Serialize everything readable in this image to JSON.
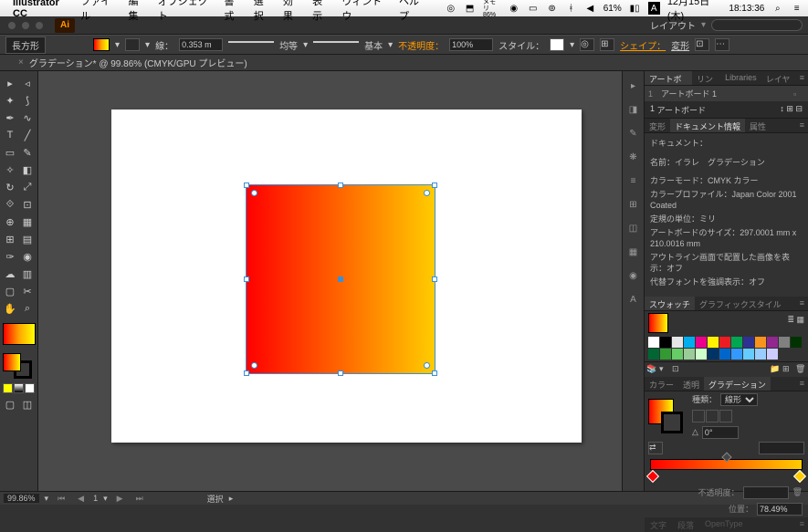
{
  "menubar": {
    "app": "Illustrator CC",
    "items": [
      "ファイル",
      "編集",
      "オブジェクト",
      "書式",
      "選択",
      "効果",
      "表示",
      "ウィンドウ",
      "ヘルプ"
    ],
    "memory": "メモリ\n86%",
    "battery": "61%",
    "date": "12月15日(木)",
    "time": "18:13:36"
  },
  "appbar": {
    "ai": "Ai",
    "layout": "レイアウト"
  },
  "control": {
    "shape": "長方形",
    "stroke_label": "線：",
    "stroke_w": "0.353 m",
    "uniform": "均等",
    "basic": "基本",
    "opacity_label": "不透明度：",
    "opacity": "100%",
    "style_label": "スタイル：",
    "shape_link": "シェイプ：",
    "transform": "変形"
  },
  "tab": {
    "close": "×",
    "title": "グラデーション* @ 99.86% (CMYK/GPU プレビュー)"
  },
  "panels": {
    "artboard_tabs": [
      "アートボード",
      "リンク",
      "Libraries",
      "レイヤー"
    ],
    "artboard_list_num": "1",
    "artboard_list_name": "アートボード 1",
    "artboard_footer_num": "1",
    "artboard_footer_label": "アートボード",
    "doc_tabs": [
      "変形",
      "ドキュメント情報",
      "属性"
    ],
    "doc_lines": {
      "doc": "ドキュメント：",
      "name": "名前：イラレ　グラデーション",
      "mode": "カラーモード：CMYK カラー",
      "profile": "カラープロファイル：Japan Color 2001 Coated",
      "ruler": "定規の単位：ミリ",
      "size": "アートボードのサイズ：297.0001 mm x 210.0016 mm",
      "outline": "アウトライン画面で配置した画像を表示：オフ",
      "font": "代替フォントを強調表示：オフ"
    },
    "swatch_tabs": [
      "スウォッチ",
      "グラフィックスタイル"
    ],
    "color_tabs": [
      "カラー",
      "透明",
      "グラデーション"
    ],
    "grad": {
      "type_label": "種類：",
      "type_value": "線形",
      "angle": "0°",
      "opacity_label": "不透明度：",
      "pos_label": "位置：",
      "pos_value": "78.49%"
    },
    "bottom_tabs": [
      "文字",
      "段落",
      "OpenType"
    ]
  },
  "status": {
    "zoom": "99.86%",
    "selected": "選択"
  },
  "swatches": [
    "#ffffff",
    "#000000",
    "#e6e6e6",
    "#00aeef",
    "#ec008c",
    "#fff200",
    "#ed1c24",
    "#00a651",
    "#2e3192",
    "#f7941d",
    "#92278f",
    "#808080",
    "#003300",
    "#006633",
    "#339933",
    "#66cc66",
    "#99cc99",
    "#ccffcc",
    "#003366",
    "#0066cc",
    "#3399ff",
    "#66ccff",
    "#99ccff",
    "#ccccff"
  ]
}
